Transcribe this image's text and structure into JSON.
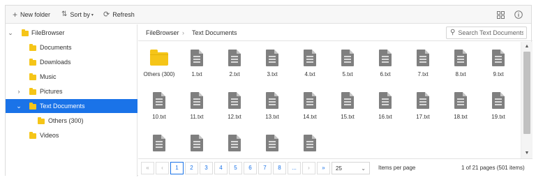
{
  "toolbar": {
    "new_folder": "New folder",
    "sort_by": "Sort by",
    "refresh": "Refresh"
  },
  "tree": {
    "root": "FileBrowser",
    "items": [
      {
        "label": "Documents"
      },
      {
        "label": "Downloads"
      },
      {
        "label": "Music"
      },
      {
        "label": "Pictures"
      },
      {
        "label": "Text Documents"
      },
      {
        "label": "Others (300)"
      },
      {
        "label": "Videos"
      }
    ]
  },
  "breadcrumb": {
    "items": [
      "FileBrowser",
      "Text Documents"
    ],
    "separator": "›"
  },
  "search": {
    "placeholder": "Search Text Documents"
  },
  "files": [
    {
      "name": "Others (300)",
      "type": "folder"
    },
    {
      "name": "1.txt",
      "type": "txt"
    },
    {
      "name": "2.txt",
      "type": "txt"
    },
    {
      "name": "3.txt",
      "type": "txt"
    },
    {
      "name": "4.txt",
      "type": "txt"
    },
    {
      "name": "5.txt",
      "type": "txt"
    },
    {
      "name": "6.txt",
      "type": "txt"
    },
    {
      "name": "7.txt",
      "type": "txt"
    },
    {
      "name": "8.txt",
      "type": "txt"
    },
    {
      "name": "9.txt",
      "type": "txt"
    },
    {
      "name": "10.txt",
      "type": "txt"
    },
    {
      "name": "11.txt",
      "type": "txt"
    },
    {
      "name": "12.txt",
      "type": "txt"
    },
    {
      "name": "13.txt",
      "type": "txt"
    },
    {
      "name": "14.txt",
      "type": "txt"
    },
    {
      "name": "15.txt",
      "type": "txt"
    },
    {
      "name": "16.txt",
      "type": "txt"
    },
    {
      "name": "17.txt",
      "type": "txt"
    },
    {
      "name": "18.txt",
      "type": "txt"
    },
    {
      "name": "19.txt",
      "type": "txt"
    },
    {
      "name": "",
      "type": "txt"
    },
    {
      "name": "",
      "type": "txt"
    },
    {
      "name": "",
      "type": "txt"
    },
    {
      "name": "",
      "type": "txt"
    },
    {
      "name": "",
      "type": "txt"
    }
  ],
  "pager": {
    "first": "«",
    "prev": "‹",
    "pages": [
      "1",
      "2",
      "3",
      "4",
      "5",
      "6",
      "7",
      "8",
      "..."
    ],
    "current": "1",
    "next": "›",
    "last": "»",
    "page_size": "25",
    "items_per_page": "Items per page",
    "info": "1 of 21 pages (501 items)"
  },
  "colors": {
    "accent": "#1a73e8",
    "folder": "#f5c518",
    "file_icon": "#7f7f7f"
  },
  "icons": [
    "plus-icon",
    "sort-icon",
    "refresh-icon",
    "grid-view-icon",
    "info-icon",
    "search-icon",
    "folder-icon",
    "text-file-icon",
    "chevron-down-icon",
    "chevron-right-icon"
  ]
}
